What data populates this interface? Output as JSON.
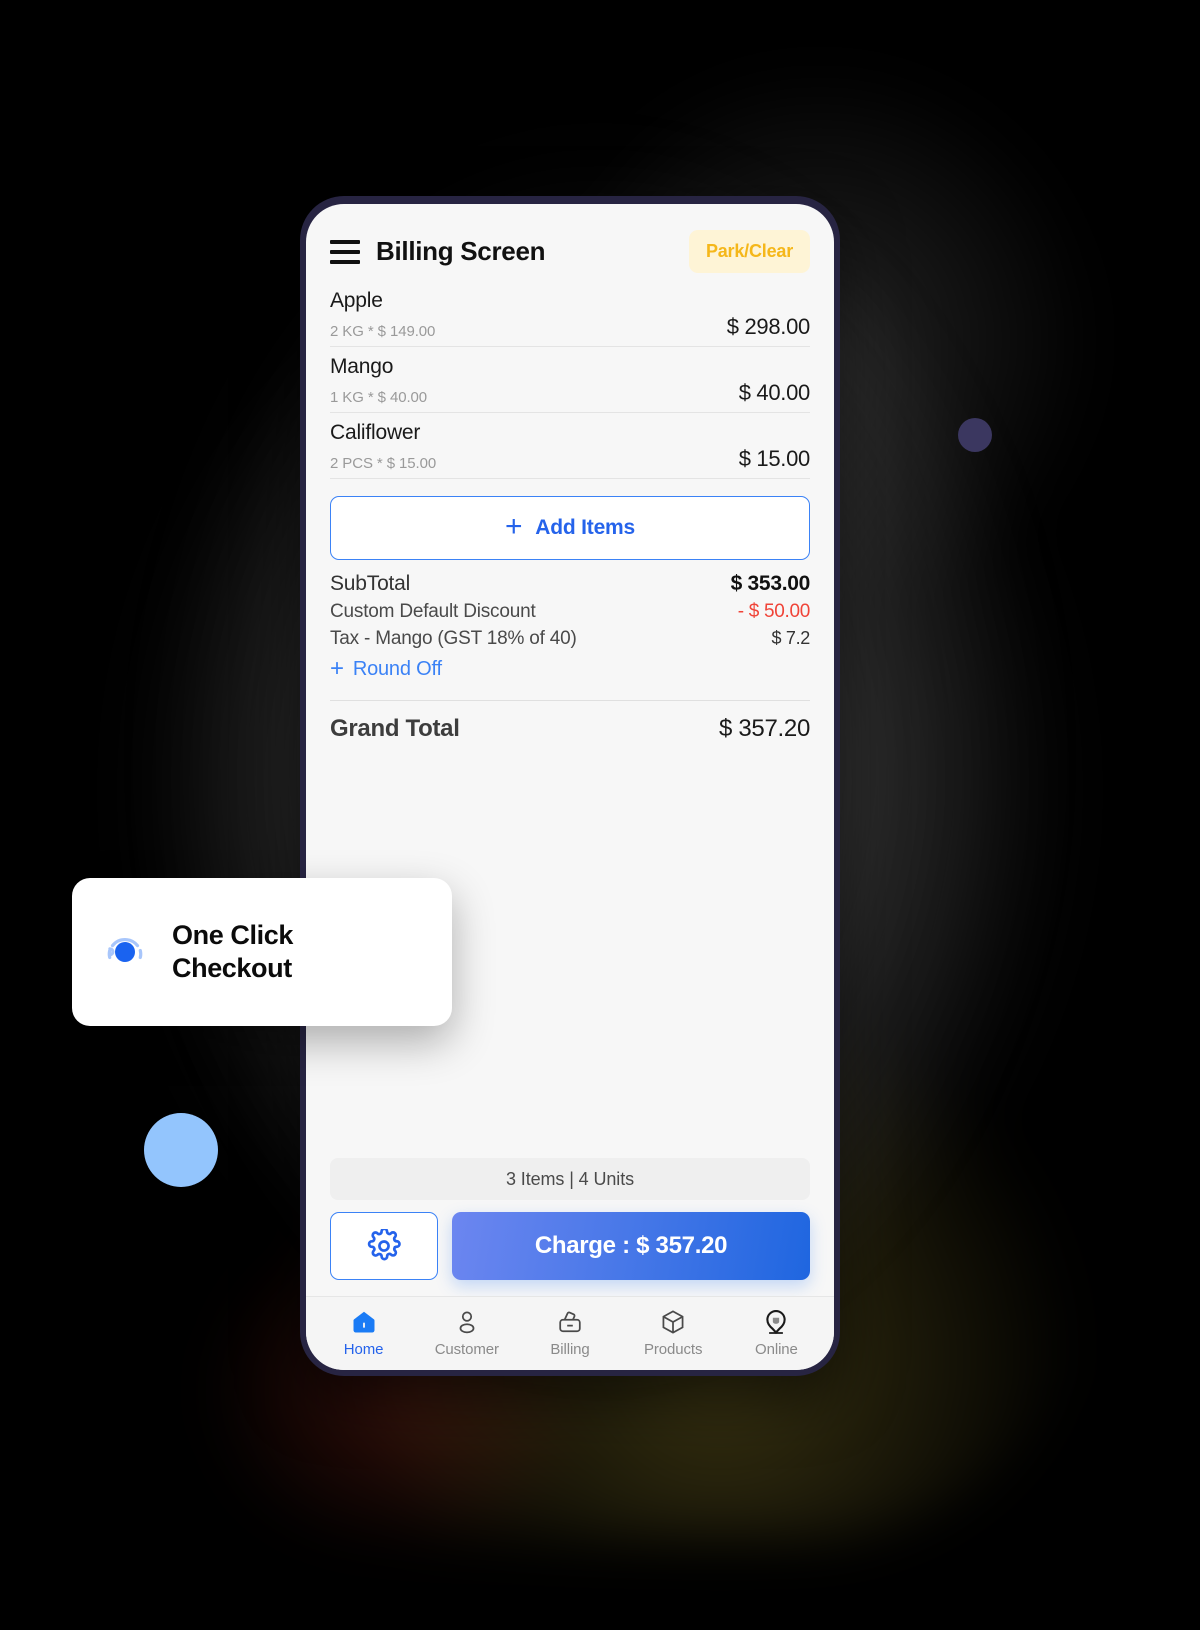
{
  "app": {
    "title": "Billing Screen",
    "menu_icon": "hamburger-icon",
    "park_clear_label": "Park/Clear"
  },
  "items": [
    {
      "name": "Apple",
      "detail": "2 KG * $ 149.00",
      "amount": "$ 298.00"
    },
    {
      "name": "Mango",
      "detail": "1 KG * $ 40.00",
      "amount": "$ 40.00"
    },
    {
      "name": "Califlower",
      "detail": "2 PCS * $ 15.00",
      "amount": "$ 15.00"
    }
  ],
  "add_items": {
    "label": "Add Items",
    "plus": "+"
  },
  "totals": {
    "subtotal_label": "SubTotal",
    "subtotal_value": "$ 353.00",
    "discount_label": "Custom Default Discount",
    "discount_value": "- $ 50.00",
    "tax_label": "Tax - Mango (GST 18% of 40)",
    "tax_value": "$ 7.2",
    "round_off_label": "Round Off",
    "round_off_plus": "+",
    "grand_total_label": "Grand Total",
    "grand_total_value": "$ 357.20"
  },
  "summary": {
    "count_text": "3 Items | 4 Units"
  },
  "actions": {
    "settings_icon": "gear-icon",
    "charge_label": "Charge : $ 357.20"
  },
  "bottom_nav": [
    {
      "label": "Home",
      "icon": "home-icon",
      "active": true
    },
    {
      "label": "Customer",
      "icon": "person-icon",
      "active": false
    },
    {
      "label": "Billing",
      "icon": "bag-icon",
      "active": false
    },
    {
      "label": "Products",
      "icon": "cube-icon",
      "active": false
    },
    {
      "label": "Online",
      "icon": "location-icon",
      "active": false
    }
  ],
  "callout": {
    "icon": "radio-target-icon",
    "line1": "One Click",
    "line2": "Checkout"
  },
  "colors": {
    "accent_blue": "#2563EB",
    "park_yellow": "#F5B71A",
    "discount_red": "#F04438",
    "phone_frame": "#272442",
    "light_blue_dot": "#93C5FD",
    "purple_dot": "#3B3760"
  }
}
